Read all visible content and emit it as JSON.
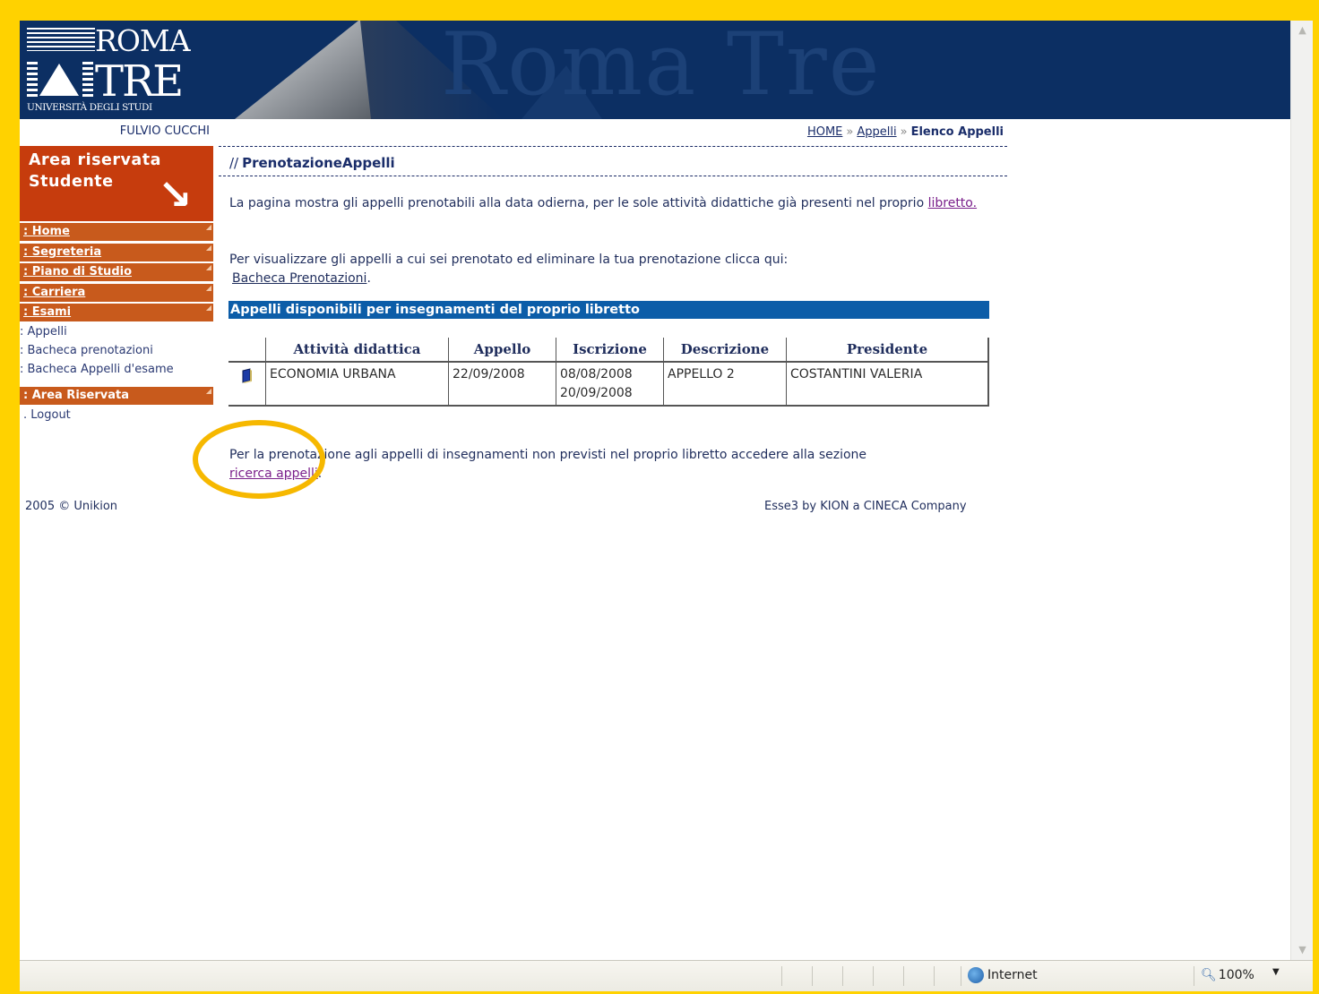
{
  "banner": {
    "logo_top": "ROMA",
    "logo_bottom": "TRE",
    "logo_subtitle": "UNIVERSITÀ DEGLI STUDI",
    "background_word": "Roma Tre"
  },
  "user": {
    "name": "FULVIO CUCCHI"
  },
  "breadcrumb": {
    "home": "HOME",
    "sep1": "»",
    "appelli": "Appelli",
    "sep2": "»",
    "current": "Elenco Appelli"
  },
  "sidebar": {
    "title": "Area riservata\nStudente",
    "nav": [
      {
        "label": ": Home"
      },
      {
        "label": ": Segreteria"
      },
      {
        "label": ": Piano di Studio"
      },
      {
        "label": ": Carriera"
      },
      {
        "label": ": Esami"
      }
    ],
    "sub_items": [
      {
        "label": ": Appelli"
      },
      {
        "label": ": Bacheca prenotazioni"
      },
      {
        "label": ": Bacheca Appelli d'esame"
      }
    ],
    "reserved": {
      "label": ": Area Riservata"
    },
    "logout": {
      "label": ". Logout"
    }
  },
  "main": {
    "title_prefix": "//",
    "title": "PrenotazioneAppelli",
    "intro_text": "La pagina mostra gli appelli prenotabili alla data odierna, per le sole attività  didattiche già  presenti nel proprio ",
    "intro_link": "libretto.",
    "bookings_text": "Per visualizzare gli appelli a cui sei prenotato ed eliminare la tua prenotazione clicca qui:",
    "bookings_link": "Bacheca Prenotazioni",
    "bookings_end": ".",
    "section_title": "Appelli disponibili per insegnamenti del proprio libretto",
    "table": {
      "headers": [
        "",
        "Attività didattica",
        "Appello",
        "Iscrizione",
        "Descrizione",
        "Presidente"
      ],
      "rows": [
        {
          "icon": "book-icon",
          "activity": "ECONOMIA URBANA",
          "appello": "22/09/2008",
          "iscrizione_from": "08/08/2008",
          "iscrizione_to": "20/09/2008",
          "descrizione": "APPELLO 2",
          "presidente": "COSTANTINI VALERIA"
        }
      ]
    },
    "other_text": "Per la prenotazione agli appelli di insegnamenti non previsti nel proprio libretto accedere alla sezione",
    "other_link": "ricerca appelli",
    "other_end": "."
  },
  "footer": {
    "left": "2005 © Unikion",
    "right": "Esse3 by KION a CINECA Company"
  },
  "statusbar": {
    "zone": "Internet",
    "zoom": "100%"
  },
  "colors": {
    "frame": "#ffd200",
    "banner": "#0c2f63",
    "sidebar_accent": "#c63c0d",
    "section_bar": "#0c5da8",
    "highlight_ring": "#f6b800"
  }
}
